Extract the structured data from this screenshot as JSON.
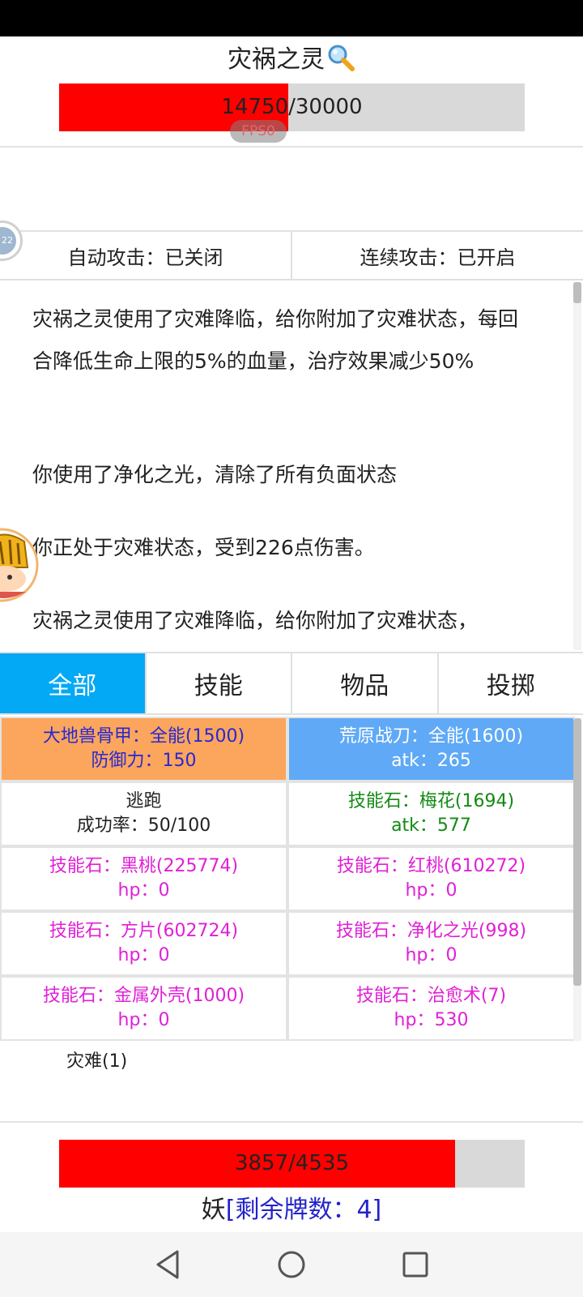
{
  "enemy": {
    "name": "灾祸之灵",
    "hp_text": "14750/30000",
    "hp_fraction": 0.4917
  },
  "fps_badge": "FPS0",
  "side_avatar_badge": "22",
  "toggles": {
    "auto_attack": "自动攻击：已关闭",
    "continuous_attack": "连续攻击：已开启"
  },
  "log": [
    "灾祸之灵使用了灾难降临，给你附加了灾难状态，每回合降低生命上限的5%的血量，治疗效果减少50%",
    "你使用了净化之光，清除了所有负面状态",
    "你正处于灾难状态，受到226点伤害。",
    "灾祸之灵使用了灾难降临，给你附加了灾难状态，"
  ],
  "tabs": [
    {
      "label": "全部",
      "active": true
    },
    {
      "label": "技能",
      "active": false
    },
    {
      "label": "物品",
      "active": false
    },
    {
      "label": "投掷",
      "active": false
    }
  ],
  "cards": [
    {
      "line1": "大地兽骨甲：全能(1500)",
      "line2": "防御力：150",
      "bg": "#fba55d",
      "color": "#2828d2"
    },
    {
      "line1": "荒原战刀：全能(1600)",
      "line2": "atk：265",
      "bg": "#5fa9f6",
      "color": "#ffffff"
    },
    {
      "line1": "逃跑",
      "line2": "成功率：50/100",
      "bg": "#ffffff",
      "color": "#222222"
    },
    {
      "line1": "技能石：梅花(1694)",
      "line2": "atk：577",
      "bg": "#ffffff",
      "color": "#138a13"
    },
    {
      "line1": "技能石：黑桃(225774)",
      "line2": "hp：0",
      "bg": "#ffffff",
      "color": "#e020d6"
    },
    {
      "line1": "技能石：红桃(610272)",
      "line2": "hp：0",
      "bg": "#ffffff",
      "color": "#e020d6"
    },
    {
      "line1": "技能石：方片(602724)",
      "line2": "hp：0",
      "bg": "#ffffff",
      "color": "#e020d6"
    },
    {
      "line1": "技能石：净化之光(998)",
      "line2": "hp：0",
      "bg": "#ffffff",
      "color": "#e020d6"
    },
    {
      "line1": "技能石：金属外壳(1000)",
      "line2": "hp：0",
      "bg": "#ffffff",
      "color": "#e020d6"
    },
    {
      "line1": "技能石：治愈术(7)",
      "line2": "hp：530",
      "bg": "#ffffff",
      "color": "#e020d6"
    }
  ],
  "status_effect": "灾难(1)",
  "player": {
    "hp_text": "3857/4535",
    "hp_fraction": 0.8505,
    "name": "妖",
    "deck_text": "[剩余牌数：4]"
  },
  "nav": {
    "back": "back-icon",
    "home": "home-icon",
    "recents": "recents-icon"
  }
}
